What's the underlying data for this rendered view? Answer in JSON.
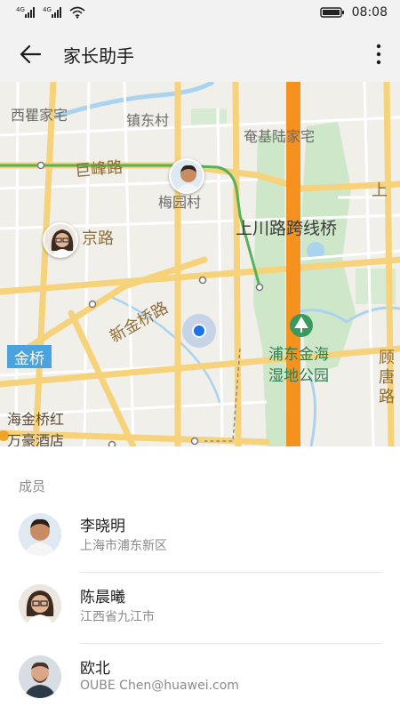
{
  "status_bar": {
    "sim1_label": "4G",
    "sim2_label": "4G",
    "time": "08:08",
    "icons": [
      "signal-icon",
      "signal-icon",
      "wifi-icon",
      "battery-icon"
    ]
  },
  "app_bar": {
    "title": "家长助手",
    "back_icon": "back-arrow-icon",
    "more_icon": "more-vertical-icon"
  },
  "map": {
    "labels": {
      "xiqu": "西瞿家宅",
      "zhendong": "镇东村",
      "anji": "奄基陆家宅",
      "jufeng": "巨峰路",
      "meiyuan": "梅园村",
      "shang": "上",
      "jing": "京路",
      "shangchuan": "上川路跨线桥",
      "xinjinqiao": "新金桥路",
      "pudong_park_1": "浦东金海",
      "pudong_park_2": "湿地公园",
      "gutang_1": "顾",
      "gutang_2": "唐",
      "gutang_3": "路",
      "jinqiao_metro": "金桥",
      "hotel_1": "海金桥红",
      "hotel_2": "万豪酒店"
    },
    "colors": {
      "road_major": "#f6d27a",
      "metro_line": "#f5921f",
      "route": "#55b15a",
      "park": "#c9e4c5",
      "water": "#a9d3ee"
    }
  },
  "members": {
    "header": "成员",
    "items": [
      {
        "name": "李晓明",
        "subtitle": "上海市浦东新区",
        "avatar": "avatar-man-icon"
      },
      {
        "name": "陈晨曦",
        "subtitle": "江西省九江市",
        "avatar": "avatar-woman-icon"
      },
      {
        "name": "欧北",
        "subtitle": "OUBE Chen@huawei.com",
        "avatar": "avatar-man-beard-icon"
      }
    ]
  }
}
